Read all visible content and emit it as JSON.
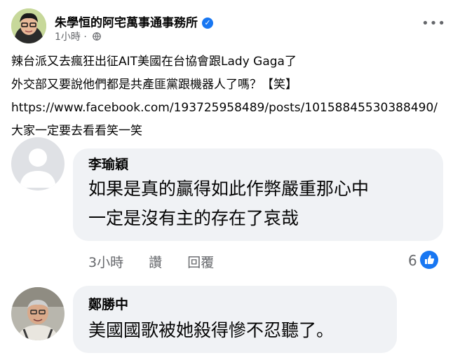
{
  "post": {
    "author": "朱學恒的阿宅萬事通事務所",
    "time": "1小時",
    "separator": "·",
    "more_label": "•••",
    "lines": [
      "辣台派又去瘋狂出征AIT美國在台協會跟Lady Gaga了",
      "外交部又要說他們都是共產匪黨跟機器人了嗎？【笑】",
      "https://www.facebook.com/193725958489/posts/10158845530388490/",
      "大家一定要去看看笑一笑"
    ]
  },
  "comments": [
    {
      "author": "李瑜穎",
      "text_lines": [
        "如果是真的贏得如此作弊嚴重那心中",
        "一定是沒有主的存在了哀哉"
      ],
      "time": "3小時",
      "like_label": "讚",
      "reply_label": "回覆",
      "like_count": "6"
    },
    {
      "author": "鄭勝中",
      "text_lines": [
        "美國國歌被她殺得慘不忍聽了。"
      ]
    }
  ],
  "colors": {
    "accent": "#1877f2",
    "bubble": "#f0f2f5",
    "secondary_text": "#65676b"
  }
}
